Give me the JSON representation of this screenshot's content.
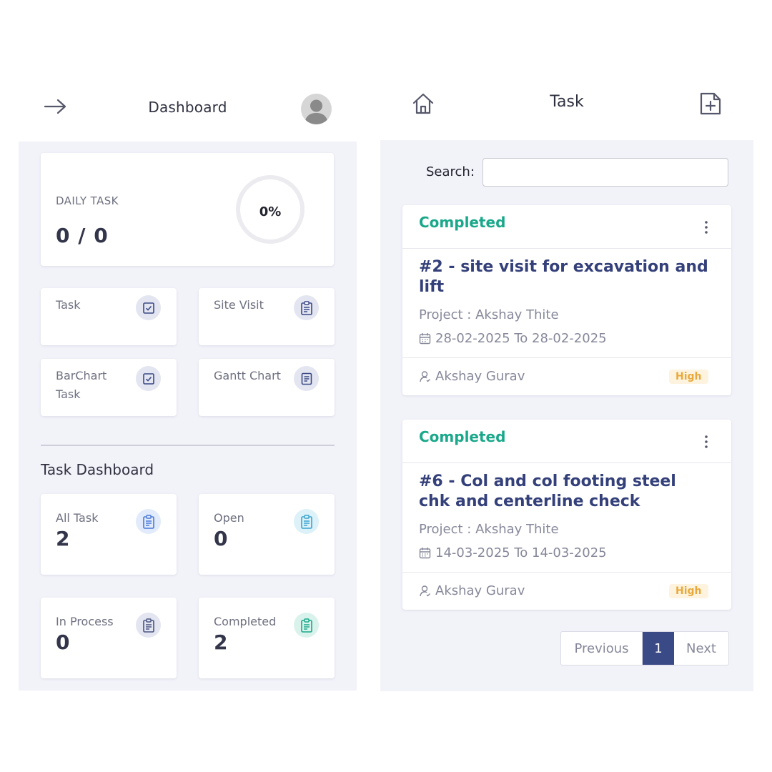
{
  "dashboard": {
    "title": "Dashboard",
    "daily_task": {
      "label": "DAILY TASK",
      "value": "0 / 0",
      "percent": "0%",
      "progress": 0
    },
    "tiles": [
      {
        "label": "Task",
        "icon": "checkbox-icon"
      },
      {
        "label": "Site Visit",
        "icon": "clipboard-icon"
      },
      {
        "label": "BarChart Task",
        "icon": "checkbox-icon"
      },
      {
        "label": "Gantt Chart",
        "icon": "document-icon"
      }
    ],
    "section_title": "Task Dashboard",
    "stats": [
      {
        "label": "All Task",
        "value": "2",
        "color": "#4a79d6",
        "bubble": "#e2ebfb"
      },
      {
        "label": "Open",
        "value": "0",
        "color": "#3aa4cf",
        "bubble": "#dcf1f8"
      },
      {
        "label": "In Process",
        "value": "0",
        "color": "#4a5480",
        "bubble": "#e3e5f1"
      },
      {
        "label": "Completed",
        "value": "2",
        "color": "#1aa88a",
        "bubble": "#d9f3ec"
      }
    ]
  },
  "task_page": {
    "title": "Task",
    "search": {
      "label": "Search:",
      "value": "",
      "placeholder": ""
    },
    "tasks": [
      {
        "status": "Completed",
        "title": "#2 - site visit for excavation and lift",
        "project": "Project : Akshay Thite",
        "dates": "28-02-2025 To 28-02-2025",
        "assignee": "Akshay Gurav",
        "priority": "High"
      },
      {
        "status": "Completed",
        "title": "#6 - Col and col footing steel chk and centerline check",
        "project": "Project : Akshay Thite",
        "dates": "14-03-2025 To 14-03-2025",
        "assignee": "Akshay Gurav",
        "priority": "High"
      }
    ],
    "pagination": {
      "previous": "Previous",
      "current": "1",
      "next": "Next"
    }
  },
  "colors": {
    "accent": "#3a4a86",
    "status_completed": "#1aa88a",
    "priority_high": "#e8a93a",
    "panel_bg": "#f2f2f9"
  }
}
